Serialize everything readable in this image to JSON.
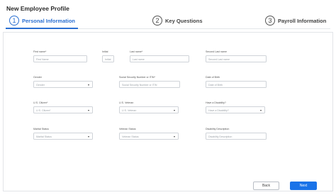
{
  "page": {
    "title": "New Employee Profile"
  },
  "steps": [
    {
      "number": "1",
      "label": "Personal Information"
    },
    {
      "number": "2",
      "label": "Key Questions"
    },
    {
      "number": "3",
      "label": "Payroll Information"
    }
  ],
  "form": {
    "first_name": {
      "label": "First name*",
      "placeholder": "First Name"
    },
    "initial": {
      "label": "Initial",
      "placeholder": "Initial"
    },
    "last_name": {
      "label": "Last name*",
      "placeholder": "Last name"
    },
    "second_last_name": {
      "label": "Second Last name",
      "placeholder": "Second Last name"
    },
    "gender": {
      "label": "Gender",
      "placeholder": "Gender"
    },
    "ssn": {
      "label": "Social Security Number or ITIN*",
      "placeholder": "Social Security Number or ITIN"
    },
    "dob": {
      "label": "Date of Birth",
      "placeholder": "Date of Birth"
    },
    "us_citizen": {
      "label": "U.S. Citizen*",
      "placeholder": "U.S. Citizen*"
    },
    "us_veteran": {
      "label": "U.S. Veteran",
      "placeholder": "U.S. Veteran"
    },
    "disability": {
      "label": "Have a Disability?",
      "placeholder": "Have a Disability?"
    },
    "marital_status": {
      "label": "Marital Status",
      "placeholder": "Marital Status"
    },
    "veteran_status": {
      "label": "Veteran Status",
      "placeholder": "Veteran Status"
    },
    "disability_description": {
      "label": "Disability Description",
      "placeholder": "Disability Description"
    }
  },
  "buttons": {
    "back": "Back",
    "next": "Next"
  },
  "colors": {
    "accent": "#2a6fd1",
    "primary_button": "#1a73e8"
  }
}
